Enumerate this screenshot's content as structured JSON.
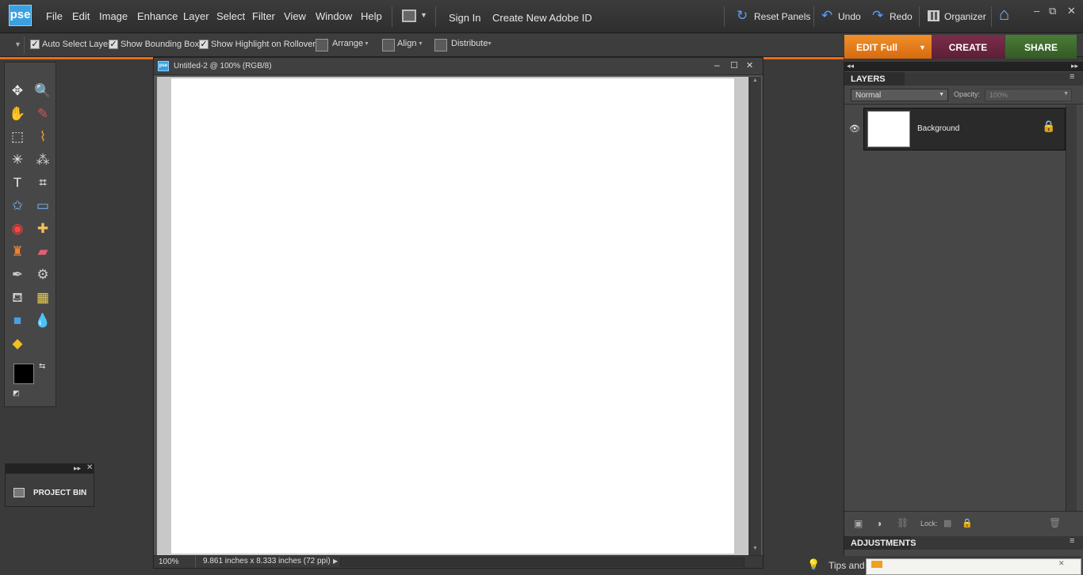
{
  "app": {
    "logo": "pse"
  },
  "menu": [
    "File",
    "Edit",
    "Image",
    "Enhance",
    "Layer",
    "Select",
    "Filter",
    "View",
    "Window",
    "Help"
  ],
  "account": {
    "sign_in": "Sign In",
    "create_id": "Create New Adobe ID"
  },
  "actions": {
    "reset_panels": "Reset Panels",
    "undo": "Undo",
    "redo": "Redo",
    "organizer": "Organizer"
  },
  "window_controls": {
    "minimize": "–",
    "restore": "⧉",
    "close": "✕"
  },
  "options": {
    "auto_select_layer": "Auto Select Layer",
    "show_bounding_box": "Show Bounding Box",
    "show_highlight": "Show Highlight on Rollover",
    "arrange": "Arrange",
    "align": "Align",
    "distribute": "Distribute",
    "checked": "✓"
  },
  "modes": {
    "edit": "EDIT Full",
    "create": "CREATE",
    "share": "SHARE"
  },
  "colors": {
    "accent": "#e96c12",
    "edit_bg": "#e47a17",
    "create_bg": "#6d2741",
    "share_bg": "#3f6b2e"
  },
  "toolbox": {
    "collapse_glyph": "◂◂",
    "tools": [
      {
        "name": "move",
        "glyph": "✥"
      },
      {
        "name": "zoom",
        "glyph": "🔍"
      },
      {
        "name": "hand",
        "glyph": "✋"
      },
      {
        "name": "eyedropper",
        "glyph": "✎"
      },
      {
        "name": "marquee",
        "glyph": "⬚"
      },
      {
        "name": "lasso",
        "glyph": "⌇"
      },
      {
        "name": "magic-wand",
        "glyph": "✳"
      },
      {
        "name": "quick-select",
        "glyph": "⁂"
      },
      {
        "name": "type",
        "glyph": "T"
      },
      {
        "name": "crop",
        "glyph": "⌗"
      },
      {
        "name": "cookie-cutter",
        "glyph": "✩"
      },
      {
        "name": "straighten",
        "glyph": "▭"
      },
      {
        "name": "red-eye",
        "glyph": "◉"
      },
      {
        "name": "healing",
        "glyph": "✚"
      },
      {
        "name": "clone-stamp",
        "glyph": "♜"
      },
      {
        "name": "eraser",
        "glyph": "▰"
      },
      {
        "name": "brush",
        "glyph": "✒"
      },
      {
        "name": "smart-brush",
        "glyph": "⚙"
      },
      {
        "name": "paint-bucket",
        "glyph": "⛾"
      },
      {
        "name": "gradient",
        "glyph": "▦"
      },
      {
        "name": "shape",
        "glyph": "■"
      },
      {
        "name": "blur",
        "glyph": "💧"
      },
      {
        "name": "sponge",
        "glyph": "◆"
      }
    ]
  },
  "document": {
    "title": "Untitled-2 @ 100% (RGB/8)",
    "zoom": "100%",
    "info": "9.861 inches x 8.333 inches (72 ppi)"
  },
  "layers_panel": {
    "title": "LAYERS",
    "blend_mode": "Normal",
    "opacity_label": "Opacity:",
    "opacity_value": "100%",
    "layer_name": "Background",
    "lock_label": "Lock:"
  },
  "adjustments": {
    "title": "ADJUSTMENTS"
  },
  "project_bin": {
    "label": "PROJECT BIN"
  },
  "tips": {
    "label": "Tips and"
  }
}
